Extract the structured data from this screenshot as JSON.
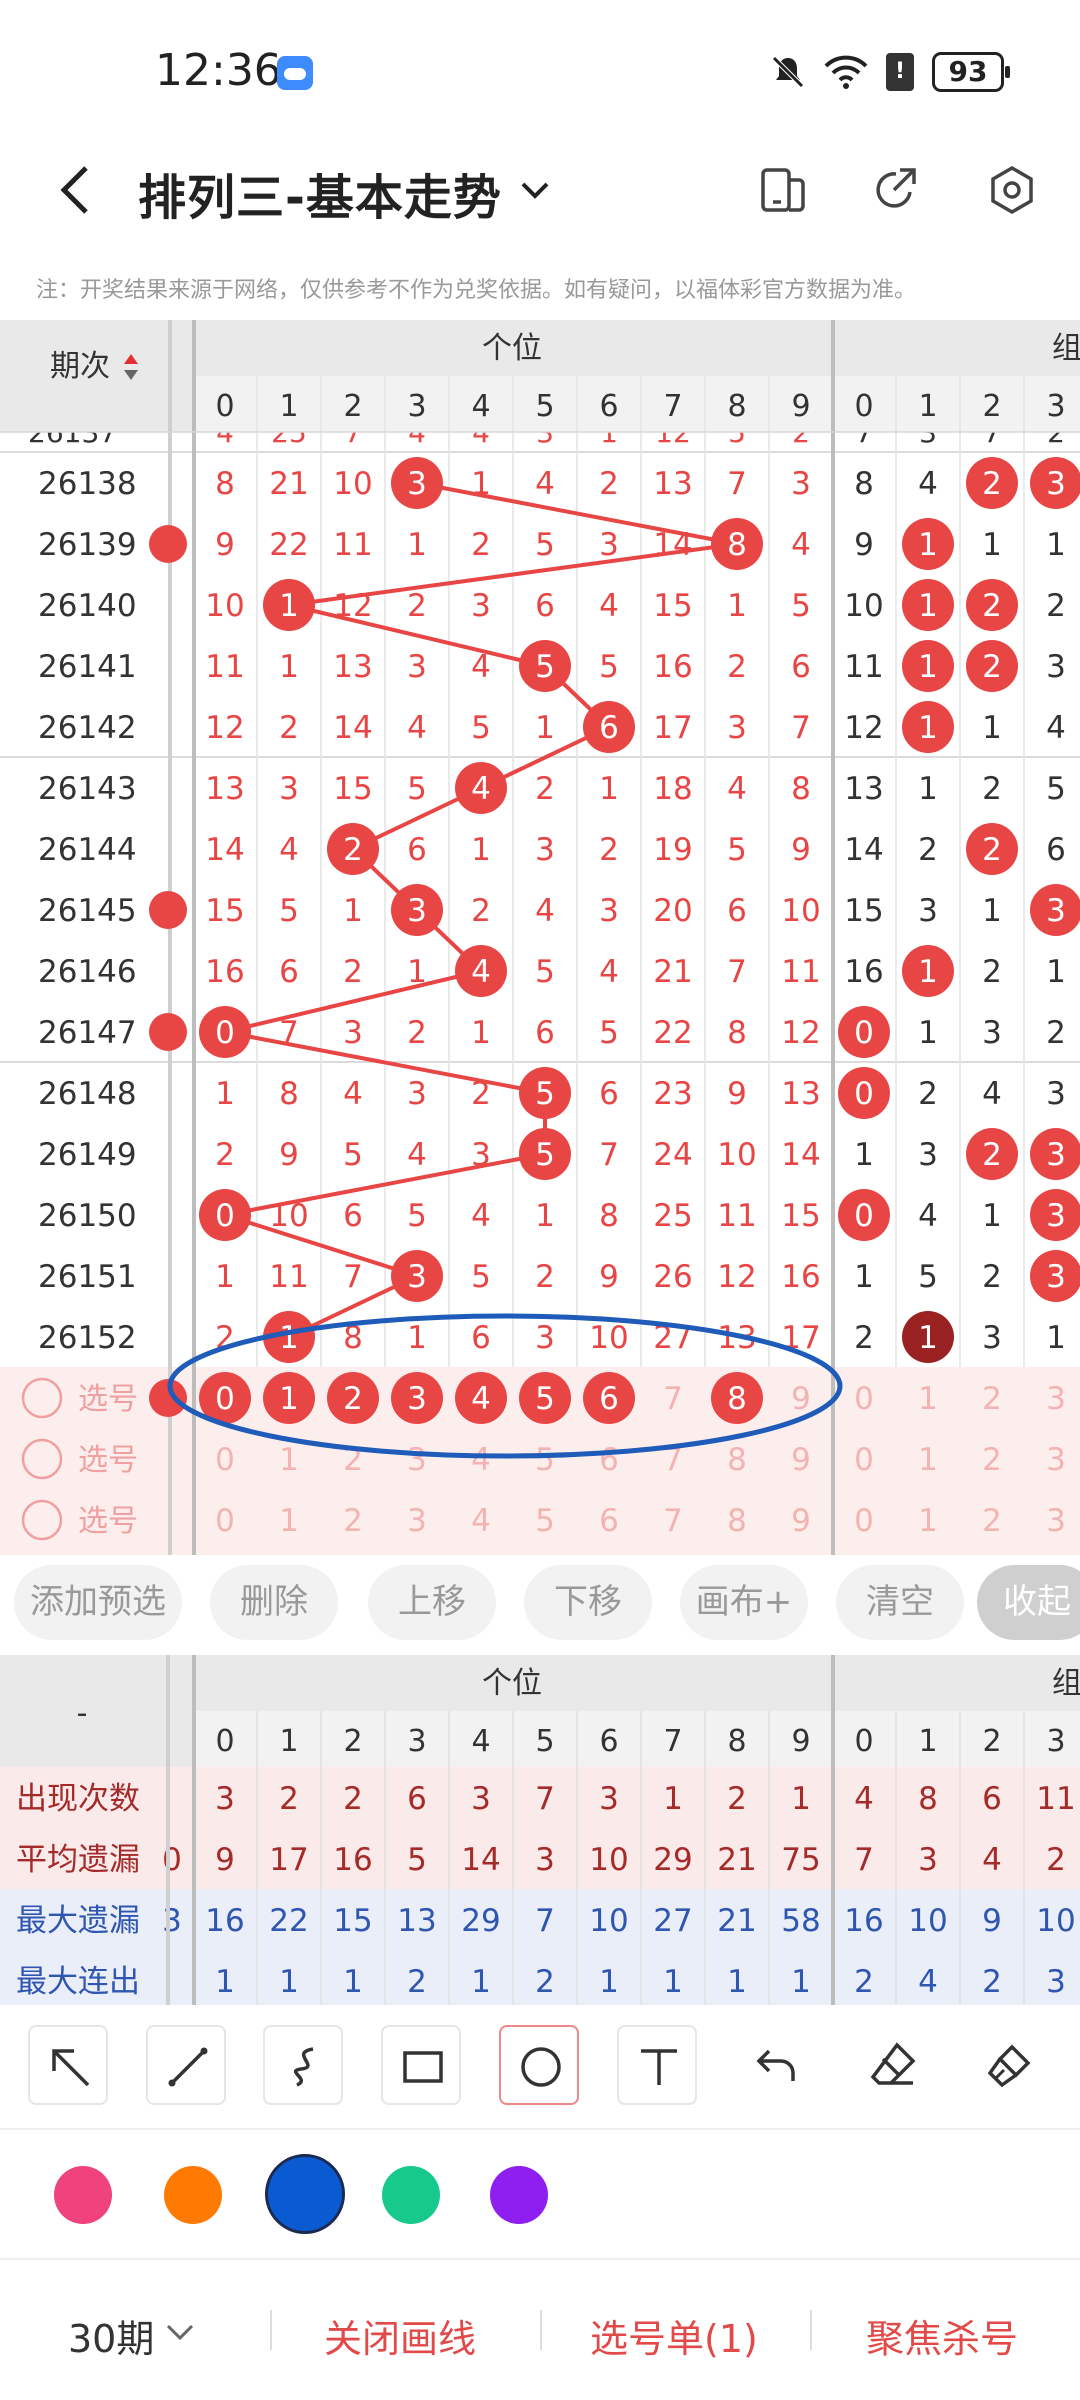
{
  "status_bar": {
    "time": "12:36",
    "battery": "93",
    "icons": [
      "cloud-icon",
      "mute-bell-icon",
      "wifi-icon",
      "sim-alert-icon",
      "battery-icon"
    ]
  },
  "header": {
    "title": "排列三-基本走势",
    "icons": [
      "back-icon",
      "chevron-down-icon",
      "layout-icon",
      "share-icon",
      "settings-icon"
    ]
  },
  "note": "注：开奖结果来源于网络，仅供参考不作为兑奖依据。如有疑问，以福体彩官方数据为准。",
  "chart": {
    "period_header": "期次",
    "group1_title": "个位",
    "group2_title": "组",
    "digits": [
      "0",
      "1",
      "2",
      "3",
      "4",
      "5",
      "6",
      "7",
      "8",
      "9"
    ],
    "digits2": [
      "0",
      "1",
      "2",
      "3"
    ],
    "partial_top_row": [
      "4",
      "25",
      "7",
      "4",
      "4",
      "3",
      "1",
      "12",
      "5",
      "2",
      "7",
      "3",
      "7",
      "2"
    ],
    "rows": [
      {
        "period": "26138",
        "vals": [
          "8",
          "21",
          "10",
          "3",
          "1",
          "4",
          "2",
          "13",
          "7",
          "3"
        ],
        "hit": 3,
        "g2": [
          "8",
          "4",
          "2",
          "3"
        ],
        "g2hit": [
          2,
          3
        ]
      },
      {
        "period": "26139",
        "vals": [
          "9",
          "22",
          "11",
          "1",
          "2",
          "5",
          "3",
          "14",
          "8",
          "4"
        ],
        "hit": 8,
        "g2": [
          "9",
          "1",
          "1",
          "1"
        ],
        "g2hit": [
          1
        ]
      },
      {
        "period": "26140",
        "vals": [
          "10",
          "1",
          "12",
          "2",
          "3",
          "6",
          "4",
          "15",
          "1",
          "5"
        ],
        "hit": 1,
        "g2": [
          "10",
          "1",
          "2",
          "2"
        ],
        "g2hit": [
          1,
          2
        ]
      },
      {
        "period": "26141",
        "vals": [
          "11",
          "1",
          "13",
          "3",
          "4",
          "5",
          "5",
          "16",
          "2",
          "6"
        ],
        "hit": 5,
        "g2": [
          "11",
          "1",
          "2",
          "3"
        ],
        "g2hit": [
          1,
          2
        ]
      },
      {
        "period": "26142",
        "vals": [
          "12",
          "2",
          "14",
          "4",
          "5",
          "1",
          "6",
          "17",
          "3",
          "7"
        ],
        "hit": 6,
        "g2": [
          "12",
          "1",
          "1",
          "4"
        ],
        "g2hit": [
          1
        ]
      },
      {
        "period": "26143",
        "vals": [
          "13",
          "3",
          "15",
          "5",
          "4",
          "2",
          "1",
          "18",
          "4",
          "8"
        ],
        "hit": 4,
        "g2": [
          "13",
          "1",
          "2",
          "5"
        ],
        "g2hit": []
      },
      {
        "period": "26144",
        "vals": [
          "14",
          "4",
          "2",
          "6",
          "1",
          "3",
          "2",
          "19",
          "5",
          "9"
        ],
        "hit": 2,
        "g2": [
          "14",
          "2",
          "2",
          "6"
        ],
        "g2hit": [
          2
        ]
      },
      {
        "period": "26145",
        "vals": [
          "15",
          "5",
          "1",
          "3",
          "2",
          "4",
          "3",
          "20",
          "6",
          "10"
        ],
        "hit": 3,
        "g2": [
          "15",
          "3",
          "1",
          "3"
        ],
        "g2hit": [
          3
        ]
      },
      {
        "period": "26146",
        "vals": [
          "16",
          "6",
          "2",
          "1",
          "4",
          "5",
          "4",
          "21",
          "7",
          "11"
        ],
        "hit": 4,
        "g2": [
          "16",
          "1",
          "2",
          "1"
        ],
        "g2hit": [
          1
        ]
      },
      {
        "period": "26147",
        "vals": [
          "0",
          "7",
          "3",
          "2",
          "1",
          "6",
          "5",
          "22",
          "8",
          "12"
        ],
        "hit": 0,
        "g2": [
          "0",
          "1",
          "3",
          "2"
        ],
        "g2hit": [
          0
        ]
      },
      {
        "period": "26148",
        "vals": [
          "1",
          "8",
          "4",
          "3",
          "2",
          "5",
          "6",
          "23",
          "9",
          "13"
        ],
        "hit": 5,
        "g2": [
          "0",
          "2",
          "4",
          "3"
        ],
        "g2hit": [
          0
        ]
      },
      {
        "period": "26149",
        "vals": [
          "2",
          "9",
          "5",
          "4",
          "3",
          "5",
          "7",
          "24",
          "10",
          "14"
        ],
        "hit": 5,
        "g2": [
          "1",
          "3",
          "2",
          "3"
        ],
        "g2hit": [
          2,
          3
        ]
      },
      {
        "period": "26150",
        "vals": [
          "0",
          "10",
          "6",
          "5",
          "4",
          "1",
          "8",
          "25",
          "11",
          "15"
        ],
        "hit": 0,
        "g2": [
          "0",
          "4",
          "1",
          "3"
        ],
        "g2hit": [
          0,
          3
        ]
      },
      {
        "period": "26151",
        "vals": [
          "1",
          "11",
          "7",
          "3",
          "5",
          "2",
          "9",
          "26",
          "12",
          "16"
        ],
        "hit": 3,
        "g2": [
          "1",
          "5",
          "2",
          "3"
        ],
        "g2hit": [
          3
        ]
      },
      {
        "period": "26152",
        "vals": [
          "2",
          "1",
          "8",
          "1",
          "6",
          "3",
          "10",
          "27",
          "13",
          "17"
        ],
        "hit": 1,
        "g2": [
          "2",
          "1",
          "3",
          "1"
        ],
        "g2hit": [],
        "g2dark": [
          1
        ]
      }
    ],
    "select_label": "选号",
    "select_rows": [
      {
        "selected": [
          0,
          1,
          2,
          3,
          4,
          5,
          6,
          8
        ]
      },
      {
        "selected": []
      },
      {
        "selected": []
      }
    ]
  },
  "actions": [
    "添加预选",
    "删除",
    "上移",
    "下移",
    "画布+",
    "清空",
    "收起"
  ],
  "stats": {
    "header_dash": "-",
    "rows": [
      {
        "label": "出现次数",
        "vals": [
          "3",
          "2",
          "2",
          "6",
          "3",
          "7",
          "3",
          "1",
          "2",
          "1"
        ],
        "g2": [
          "4",
          "8",
          "6",
          "11"
        ],
        "color": "#a52a2a"
      },
      {
        "label": "平均遗漏",
        "vals": [
          "9",
          "17",
          "16",
          "5",
          "14",
          "3",
          "10",
          "29",
          "21",
          "75"
        ],
        "g2": [
          "7",
          "3",
          "4",
          "2"
        ],
        "color": "#a52a2a"
      },
      {
        "label": "最大遗漏",
        "vals": [
          "16",
          "22",
          "15",
          "13",
          "29",
          "7",
          "10",
          "27",
          "21",
          "58"
        ],
        "g2": [
          "16",
          "10",
          "9",
          "10"
        ],
        "color": "#2f56b0"
      },
      {
        "label": "最大连出",
        "vals": [
          "1",
          "1",
          "1",
          "2",
          "1",
          "2",
          "1",
          "1",
          "1",
          "1"
        ],
        "g2": [
          "2",
          "4",
          "2",
          "3"
        ],
        "color": "#2f56b0"
      }
    ],
    "left_partial": [
      "0",
      "3"
    ]
  },
  "tools": [
    "arrow-tool-icon",
    "line-tool-icon",
    "curve-tool-icon",
    "rectangle-tool-icon",
    "circle-tool-icon",
    "text-tool-icon",
    "undo-icon",
    "eraser-icon",
    "clear-brush-icon"
  ],
  "colors": [
    "#f0437d",
    "#ff7a00",
    "#0a5bd1",
    "#17c98b",
    "#8f1ff0"
  ],
  "bottom": {
    "periods": "30期",
    "close_lines": "关闭画线",
    "pick_list": "选号单(1)",
    "focus": "聚焦杀号"
  }
}
